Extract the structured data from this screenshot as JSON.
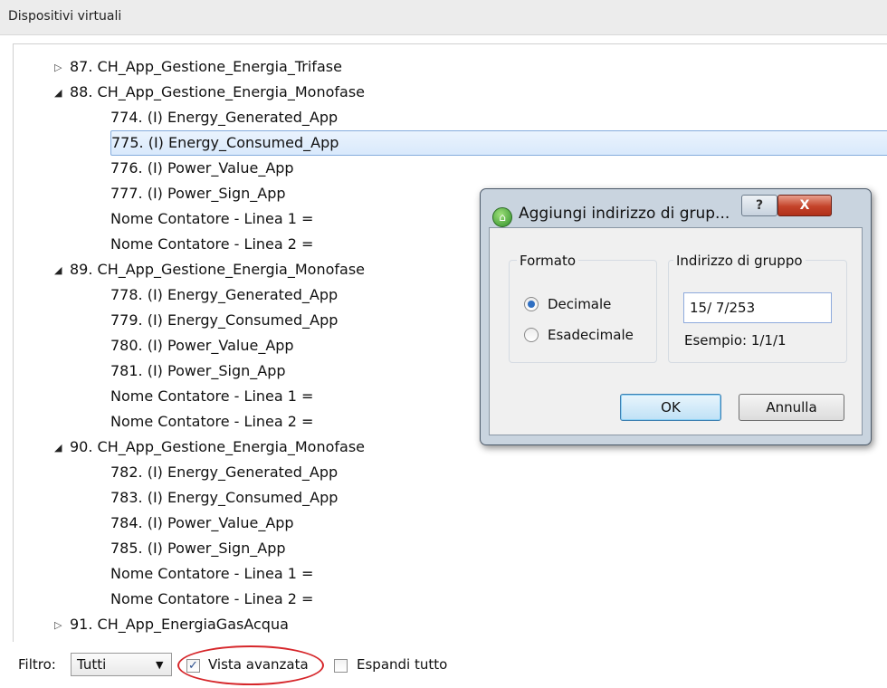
{
  "panel": {
    "title": "Dispositivi virtuali"
  },
  "tree": [
    {
      "label": "87. CH_App_Gestione_Energia_Trifase",
      "level": 0,
      "state": "collapsed"
    },
    {
      "label": "88. CH_App_Gestione_Energia_Monofase",
      "level": 0,
      "state": "expanded"
    },
    {
      "label": "774. (I) Energy_Generated_App",
      "level": 1
    },
    {
      "label": "775. (I) Energy_Consumed_App",
      "level": 1,
      "selected": true
    },
    {
      "label": "776. (I) Power_Value_App",
      "level": 1
    },
    {
      "label": "777. (I) Power_Sign_App",
      "level": 1
    },
    {
      "label": "Nome Contatore - Linea 1 =",
      "level": 1
    },
    {
      "label": "Nome Contatore - Linea 2 =",
      "level": 1
    },
    {
      "label": "89. CH_App_Gestione_Energia_Monofase",
      "level": 0,
      "state": "expanded"
    },
    {
      "label": "778. (I) Energy_Generated_App",
      "level": 1
    },
    {
      "label": "779. (I) Energy_Consumed_App",
      "level": 1
    },
    {
      "label": "780. (I) Power_Value_App",
      "level": 1
    },
    {
      "label": "781. (I) Power_Sign_App",
      "level": 1
    },
    {
      "label": "Nome Contatore - Linea 1 =",
      "level": 1
    },
    {
      "label": "Nome Contatore - Linea 2 =",
      "level": 1
    },
    {
      "label": "90. CH_App_Gestione_Energia_Monofase",
      "level": 0,
      "state": "expanded"
    },
    {
      "label": "782. (I) Energy_Generated_App",
      "level": 1
    },
    {
      "label": "783. (I) Energy_Consumed_App",
      "level": 1
    },
    {
      "label": "784. (I) Power_Value_App",
      "level": 1
    },
    {
      "label": "785. (I) Power_Sign_App",
      "level": 1
    },
    {
      "label": "Nome Contatore - Linea 1 =",
      "level": 1
    },
    {
      "label": "Nome Contatore - Linea 2 =",
      "level": 1
    },
    {
      "label": "91. CH_App_EnergiaGasAcqua",
      "level": 0,
      "state": "collapsed"
    }
  ],
  "dialog": {
    "title": "Aggiungi indirizzo di grup...",
    "help_label": "?",
    "close_label": "X",
    "format_group": {
      "legend": "Formato",
      "decimal_label": "Decimale",
      "hex_label": "Esadecimale",
      "selected": "Decimale"
    },
    "address_group": {
      "legend": "Indirizzo di gruppo",
      "value": "15/ 7/253",
      "example": "Esempio: 1/1/1"
    },
    "ok_label": "OK",
    "cancel_label": "Annulla"
  },
  "bottom": {
    "filter_label": "Filtro:",
    "filter_value": "Tutti",
    "advanced_view_label": "Vista avanzata",
    "advanced_view_checked": true,
    "expand_all_label": "Espandi tutto",
    "expand_all_checked": false
  },
  "colors": {
    "annotation": "#d6262a",
    "selection": "#d9e9fc"
  }
}
